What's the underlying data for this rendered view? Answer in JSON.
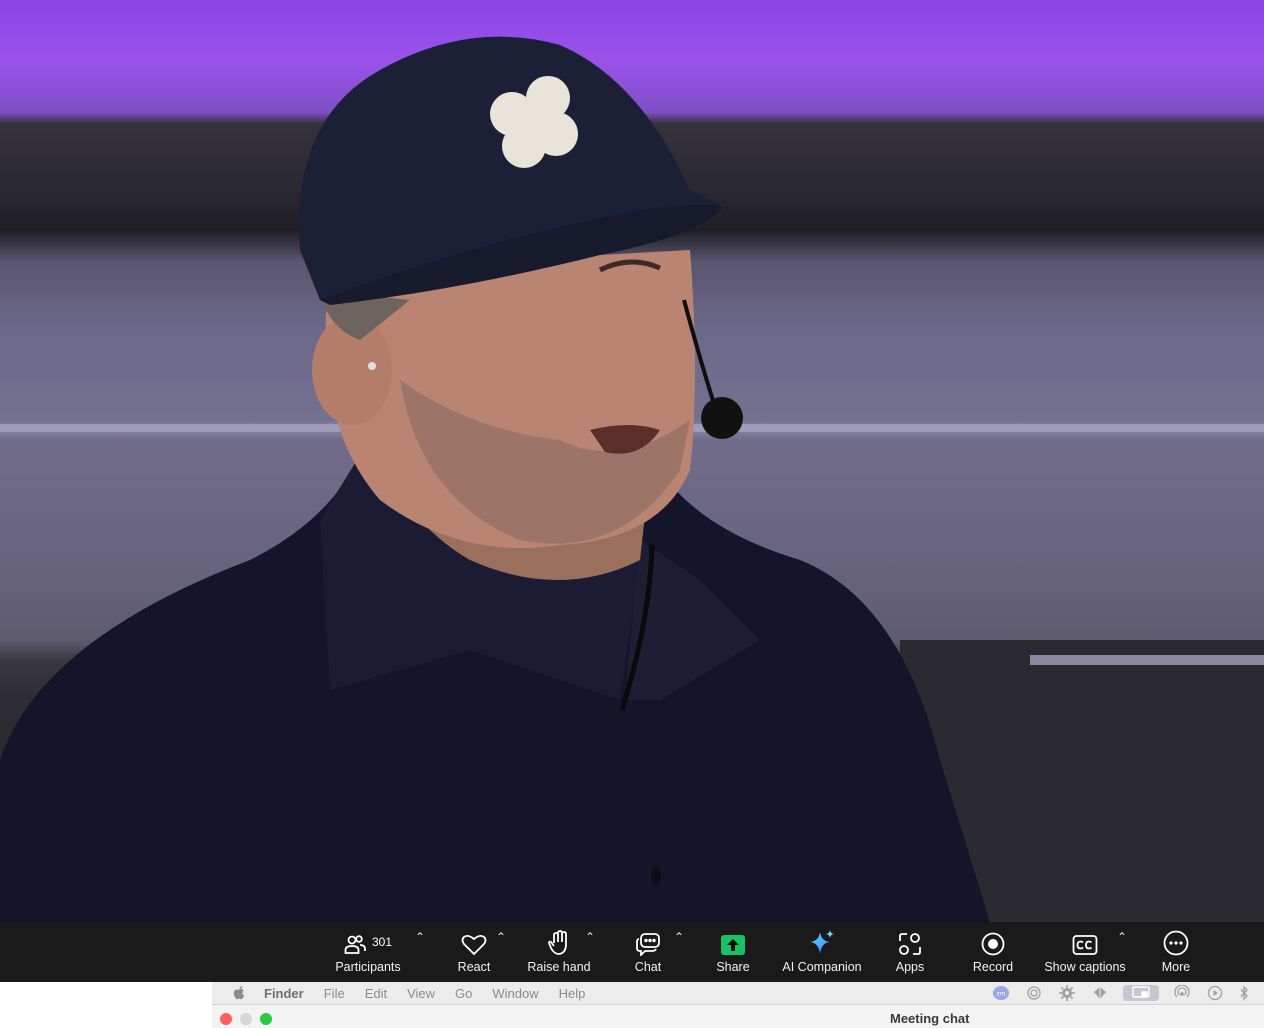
{
  "toolbar": {
    "participants": {
      "label": "Participants",
      "count": "301"
    },
    "react": {
      "label": "React"
    },
    "raise_hand": {
      "label": "Raise hand"
    },
    "chat": {
      "label": "Chat"
    },
    "share": {
      "label": "Share"
    },
    "ai_companion": {
      "label": "AI Companion"
    },
    "apps": {
      "label": "Apps"
    },
    "record": {
      "label": "Record"
    },
    "captions": {
      "label": "Show captions"
    },
    "more": {
      "label": "More"
    }
  },
  "menubar": {
    "app": "Finder",
    "items": [
      "File",
      "Edit",
      "View",
      "Go",
      "Window",
      "Help"
    ]
  },
  "window": {
    "title": "Meeting chat"
  },
  "colors": {
    "share_green": "#19c266",
    "toolbar_bg": "#1a1a1a",
    "stage_purple": "#8a45e6"
  }
}
